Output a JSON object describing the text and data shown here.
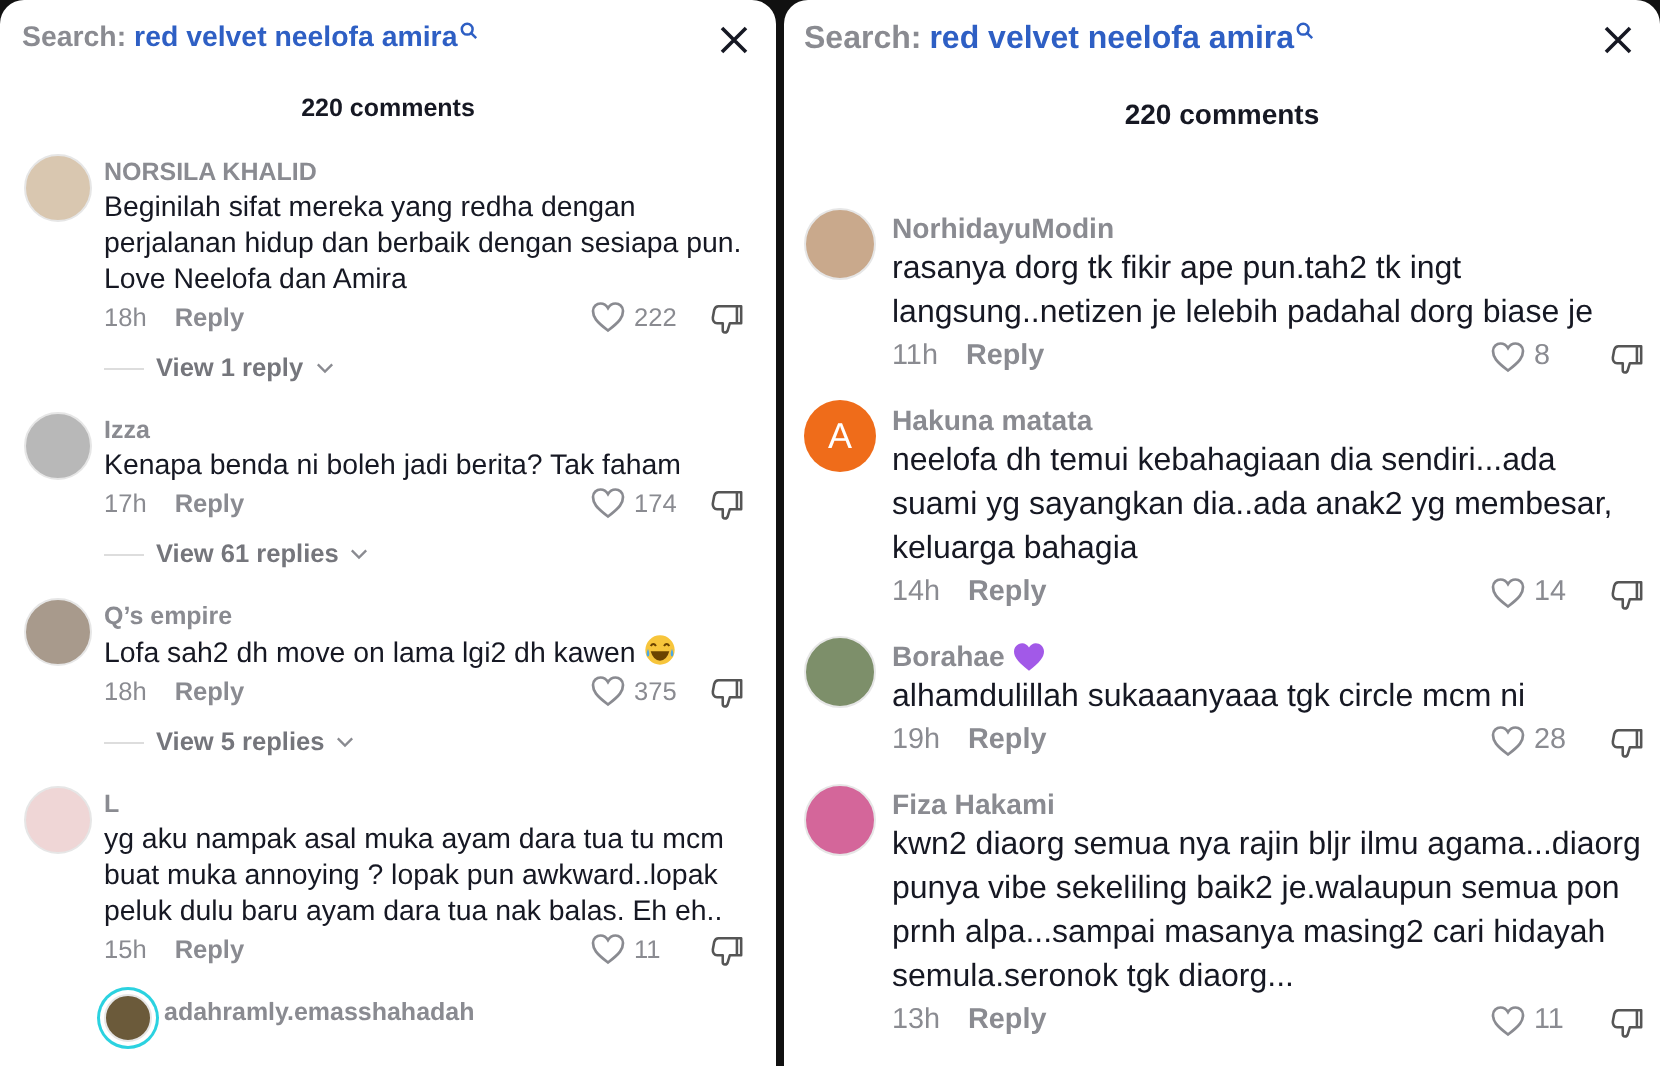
{
  "panels": [
    {
      "search": {
        "label": "Search:",
        "query": "red velvet neelofa amira"
      },
      "comment_count": "220 comments",
      "comments": [
        {
          "author": "NORSILA KHALID",
          "avatar": {
            "kind": "photo",
            "color": "#d9c7b0"
          },
          "text": "Beginilah sifat mereka yang redha dengan perjalanan hidup dan berbaik dengan sesiapa pun. Love Neelofa dan Amira",
          "emoji": false,
          "name_badge": false,
          "time": "18h",
          "reply": "Reply",
          "likes": "222",
          "replies_link": "View 1 reply"
        },
        {
          "author": "Izza",
          "avatar": {
            "kind": "photo",
            "color": "#b8b8b8"
          },
          "text": "Kenapa benda ni boleh jadi berita? Tak faham",
          "emoji": false,
          "name_badge": false,
          "time": "17h",
          "reply": "Reply",
          "likes": "174",
          "replies_link": "View 61 replies"
        },
        {
          "author": "Q’s empire",
          "avatar": {
            "kind": "photo",
            "color": "#a89a8c"
          },
          "text": "Lofa sah2 dh move on lama lgi2 dh kawen",
          "emoji": true,
          "name_badge": false,
          "time": "18h",
          "reply": "Reply",
          "likes": "375",
          "replies_link": "View 5 replies"
        },
        {
          "author": "L",
          "avatar": {
            "kind": "photo",
            "color": "#efd6d6"
          },
          "text": "yg aku nampak asal muka ayam dara tua tu mcm buat muka annoying ? lopak pun awkward..lopak peluk dulu baru ayam dara tua nak balas. Eh eh..",
          "emoji": false,
          "name_badge": false,
          "time": "15h",
          "reply": "Reply",
          "likes": "11",
          "replies": [
            {
              "author": "adahramly.emasshahadah",
              "avatar": {
                "kind": "photo",
                "color": "#6b5a3a",
                "story_ring": true
              }
            }
          ]
        }
      ]
    },
    {
      "search": {
        "label": "Search:",
        "query": "red velvet neelofa amira"
      },
      "comment_count": "220 comments",
      "comments": [
        {
          "author": "NorhidayuModin",
          "avatar": {
            "kind": "photo",
            "color": "#c9a98c"
          },
          "text": "rasanya dorg tk fikir ape pun.tah2 tk ingt langsung..netizen je lelebih padahal dorg biase je",
          "emoji": false,
          "name_badge": false,
          "time": "11h",
          "reply": "Reply",
          "likes": "8"
        },
        {
          "author": "Hakuna matata",
          "avatar": {
            "kind": "letter",
            "color": "#ef6c1a",
            "letter": "A"
          },
          "text": "neelofa dh temui kebahagiaan dia sendiri...ada suami yg sayangkan dia..ada anak2 yg membesar, keluarga bahagia",
          "emoji": false,
          "name_badge": false,
          "time": "14h",
          "reply": "Reply",
          "likes": "14"
        },
        {
          "author": "Borahae",
          "avatar": {
            "kind": "photo",
            "color": "#7d8f6a"
          },
          "text": "alhamdulillah sukaaanyaaa tgk circle mcm ni",
          "emoji": false,
          "name_badge": true,
          "time": "19h",
          "reply": "Reply",
          "likes": "28"
        },
        {
          "author": "Fiza Hakami",
          "avatar": {
            "kind": "photo",
            "color": "#d4669a"
          },
          "text": "kwn2 diaorg semua nya rajin bljr ilmu agama...diaorg punya vibe sekeliling baik2 je.walaupun semua pon prnh alpa...sampai masanya masing2 cari hidayah semula.seronok tgk diaorg...",
          "emoji": false,
          "name_badge": false,
          "time": "13h",
          "reply": "Reply",
          "likes": "11"
        }
      ]
    }
  ]
}
